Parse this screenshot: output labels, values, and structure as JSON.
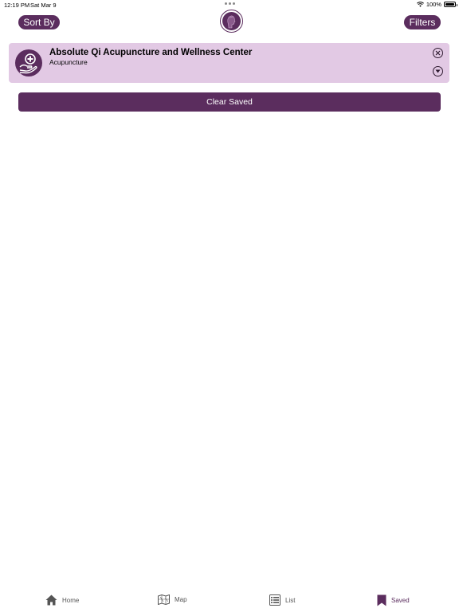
{
  "status_bar": {
    "time": "12:19 PM",
    "date": "Sat Mar 9",
    "battery": "100%"
  },
  "nav": {
    "sort_label": "Sort By",
    "filters_label": "Filters"
  },
  "saved_items": [
    {
      "title": "Absolute Qi Acupuncture and Wellness Center",
      "category": "Acupuncture"
    }
  ],
  "clear_label": "Clear Saved",
  "tabs": [
    {
      "label": "Home",
      "icon": "home-icon"
    },
    {
      "label": "Map",
      "icon": "map-icon"
    },
    {
      "label": "List",
      "icon": "list-icon"
    },
    {
      "label": "Saved",
      "icon": "bookmark-icon",
      "active": true
    }
  ],
  "colors": {
    "accent": "#5b2d5e",
    "card_bg": "#e2c9e4"
  }
}
